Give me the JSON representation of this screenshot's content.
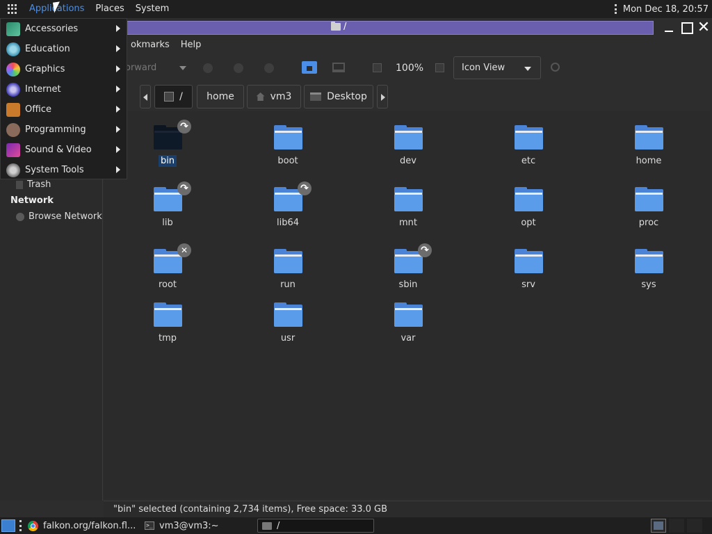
{
  "top_panel": {
    "menus": [
      "Applications",
      "Places",
      "System"
    ],
    "clock": "Mon Dec 18, 20:57"
  },
  "window": {
    "title": "/",
    "menubar": [
      "okmarks",
      "Help"
    ],
    "toolbar": {
      "forward_label": "orward",
      "zoom": "100%",
      "view_mode": "Icon View"
    },
    "pathbar": {
      "crumbs": [
        "/",
        "home",
        "vm3",
        "Desktop"
      ]
    }
  },
  "apps_menu": {
    "items": [
      "Accessories",
      "Education",
      "Graphics",
      "Internet",
      "Office",
      "Programming",
      "Sound & Video",
      "System Tools"
    ]
  },
  "sidebar": {
    "trash": "Trash",
    "network_heading": "Network",
    "browse_network": "Browse Network"
  },
  "files": [
    {
      "name": "bin",
      "emblem": "link",
      "selected": true
    },
    {
      "name": "boot",
      "emblem": "",
      "selected": false
    },
    {
      "name": "dev",
      "emblem": "",
      "selected": false
    },
    {
      "name": "etc",
      "emblem": "",
      "selected": false
    },
    {
      "name": "home",
      "emblem": "",
      "selected": false
    },
    {
      "name": "lib",
      "emblem": "link",
      "selected": false
    },
    {
      "name": "lib64",
      "emblem": "link",
      "selected": false
    },
    {
      "name": "mnt",
      "emblem": "",
      "selected": false
    },
    {
      "name": "opt",
      "emblem": "",
      "selected": false
    },
    {
      "name": "proc",
      "emblem": "",
      "selected": false
    },
    {
      "name": "root",
      "emblem": "x",
      "selected": false
    },
    {
      "name": "run",
      "emblem": "",
      "selected": false
    },
    {
      "name": "sbin",
      "emblem": "link",
      "selected": false
    },
    {
      "name": "srv",
      "emblem": "",
      "selected": false
    },
    {
      "name": "sys",
      "emblem": "",
      "selected": false
    },
    {
      "name": "tmp",
      "emblem": "",
      "selected": false
    },
    {
      "name": "usr",
      "emblem": "",
      "selected": false
    },
    {
      "name": "var",
      "emblem": "",
      "selected": false
    }
  ],
  "statusbar": {
    "text": "\"bin\" selected (containing 2,734 items), Free space: 33.0 GB"
  },
  "taskbar": {
    "tasks": [
      "falkon.org/falkon.fl...",
      "vm3@vm3:~",
      "/"
    ]
  },
  "colors": {
    "accent": "#4a8ee8",
    "title_bar": "#6a5fae",
    "folder": "#5b9cea",
    "selection": "#1b3f6b"
  }
}
